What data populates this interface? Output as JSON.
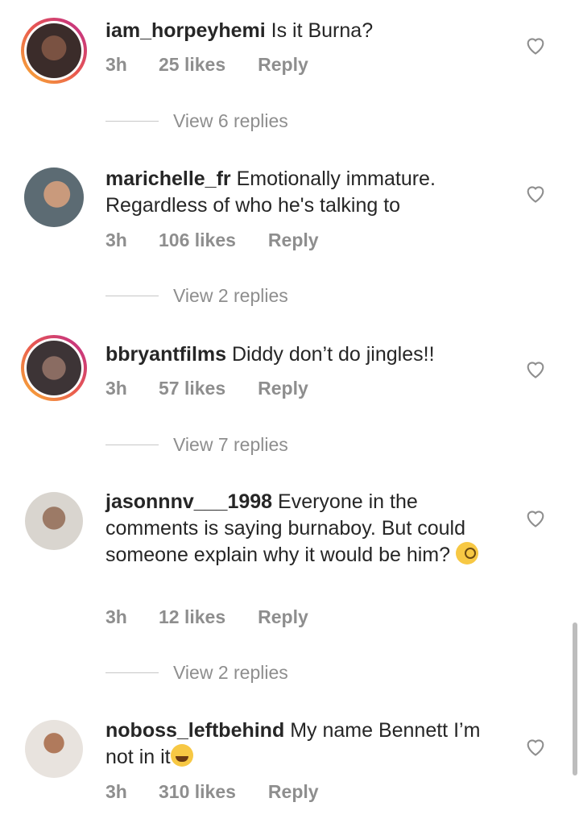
{
  "comments": [
    {
      "username": "iam_horpeyhemi",
      "text": "Is it Burna?",
      "time": "3h",
      "likes": "25 likes",
      "reply": "Reply",
      "view_replies": "View 6 replies",
      "avatar_color": "#6b4a3a",
      "story": true
    },
    {
      "username": "marichelle_fr",
      "text": "Emotionally immature. Regardless of who he's talking to",
      "time": "3h",
      "likes": "106 likes",
      "reply": "Reply",
      "view_replies": "View 2 replies",
      "avatar_color": "#a46a4f",
      "story": false
    },
    {
      "username": "bbryantfilms",
      "text": "Diddy don’t do jingles!!",
      "time": "3h",
      "likes": "57 likes",
      "reply": "Reply",
      "view_replies": "View 7 replies",
      "avatar_color": "#5a4b46",
      "story": true
    },
    {
      "username": "jasonnnv___1998",
      "text": "Everyone in the comments is saying burnaboy. But could someone explain why it would be him?",
      "time": "3h",
      "likes": "12 likes",
      "reply": "Reply",
      "view_replies": "View 2 replies",
      "avatar_color": "#7d6a5e",
      "story": false
    },
    {
      "username": "noboss_leftbehind",
      "text": "My name Bennett I’m not in it",
      "time": "3h",
      "likes": "310 likes",
      "reply": "Reply",
      "view_replies": "",
      "avatar_color": "#c9a89a",
      "story": false
    }
  ]
}
